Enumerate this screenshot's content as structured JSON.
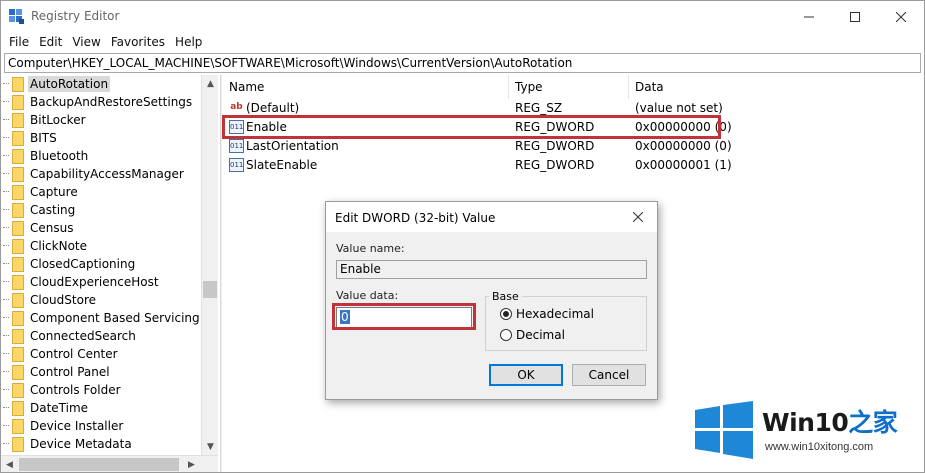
{
  "window": {
    "title": "Registry Editor",
    "controls": {
      "minimize": "minimize",
      "maximize": "maximize",
      "close": "close"
    }
  },
  "menu": [
    "File",
    "Edit",
    "View",
    "Favorites",
    "Help"
  ],
  "address": "Computer\\HKEY_LOCAL_MACHINE\\SOFTWARE\\Microsoft\\Windows\\CurrentVersion\\AutoRotation",
  "tree": {
    "items": [
      "AutoRotation",
      "BackupAndRestoreSettings",
      "BitLocker",
      "BITS",
      "Bluetooth",
      "CapabilityAccessManager",
      "Capture",
      "Casting",
      "Census",
      "ClickNote",
      "ClosedCaptioning",
      "CloudExperienceHost",
      "CloudStore",
      "Component Based Servicing",
      "ConnectedSearch",
      "Control Center",
      "Control Panel",
      "Controls Folder",
      "DateTime",
      "Device Installer",
      "Device Metadata"
    ],
    "selected": "AutoRotation"
  },
  "values": {
    "columns": {
      "name": "Name",
      "type": "Type",
      "data": "Data"
    },
    "rows": [
      {
        "icon": "string-value-icon",
        "icon_glyph": "ab",
        "name": "(Default)",
        "type": "REG_SZ",
        "data": "(value not set)"
      },
      {
        "icon": "dword-value-icon",
        "icon_glyph": "011",
        "name": "Enable",
        "type": "REG_DWORD",
        "data": "0x00000000 (0)"
      },
      {
        "icon": "dword-value-icon",
        "icon_glyph": "011",
        "name": "LastOrientation",
        "type": "REG_DWORD",
        "data": "0x00000000 (0)"
      },
      {
        "icon": "dword-value-icon",
        "icon_glyph": "011",
        "name": "SlateEnable",
        "type": "REG_DWORD",
        "data": "0x00000001 (1)"
      }
    ],
    "highlighted_row": "Enable"
  },
  "dialog": {
    "title": "Edit DWORD (32-bit) Value",
    "value_name_label": "Value name:",
    "value_name": "Enable",
    "value_data_label": "Value data:",
    "value_data": "0",
    "base_label": "Base",
    "base_options": [
      "Hexadecimal",
      "Decimal"
    ],
    "base_selected": "Hexadecimal",
    "ok_label": "OK",
    "cancel_label": "Cancel"
  },
  "watermark": {
    "brand_prefix": "Win10",
    "brand_suffix": "之家",
    "url": "www.win10xitong.com"
  },
  "colors": {
    "highlight": "#c0333b",
    "selection": "#3a75c4",
    "folder": "#fcd667",
    "brand_blue": "#0f6fc6"
  }
}
